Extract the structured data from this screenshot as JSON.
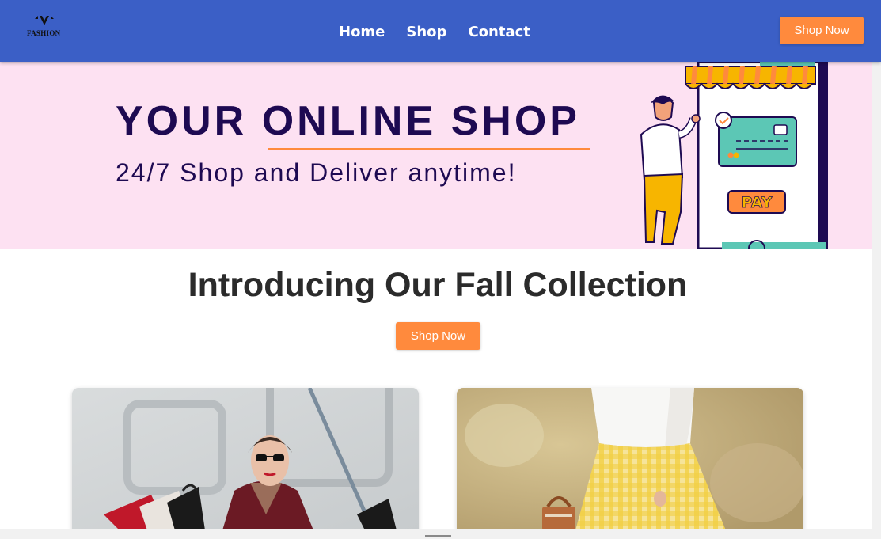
{
  "header": {
    "logo_text": "FASHION",
    "nav": [
      "Home",
      "Shop",
      "Contact"
    ],
    "cta_label": "Shop Now"
  },
  "hero": {
    "title_part1": "YOUR ",
    "title_part2": "ONLINE SHOP",
    "subtitle": "24/7 Shop and Deliver anytime!",
    "pay_label": "PAY"
  },
  "main": {
    "section_title": "Introducing Our Fall Collection",
    "cta_label": "Shop Now"
  },
  "colors": {
    "header_bg": "#3b5fc6",
    "accent": "#ff8a3d",
    "hero_bg": "#fde1f2",
    "hero_text": "#1e0a52"
  }
}
